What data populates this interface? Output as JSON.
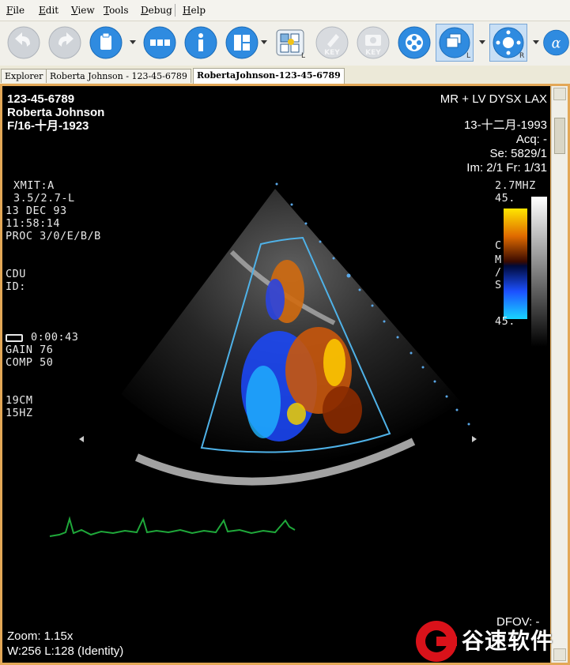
{
  "menu": {
    "items": [
      {
        "label": "File"
      },
      {
        "label": "Edit"
      },
      {
        "label": "View"
      },
      {
        "label": "Tools"
      },
      {
        "label": "Debug"
      },
      {
        "label": "Help"
      }
    ]
  },
  "toolbar": {
    "buttons": [
      {
        "name": "back-icon"
      },
      {
        "name": "forward-icon"
      },
      {
        "name": "clipboard-icon"
      },
      {
        "name": "layout-grid-icon"
      },
      {
        "name": "info-icon"
      },
      {
        "name": "tile-layout-icon"
      },
      {
        "name": "select-region-icon"
      },
      {
        "name": "key-pen-icon",
        "text": "KEY"
      },
      {
        "name": "key-camera-icon",
        "text": "KEY"
      },
      {
        "name": "cine-reel-icon"
      },
      {
        "name": "stack-icon",
        "sub": "L"
      },
      {
        "name": "pan-tool-icon",
        "sub": "R"
      },
      {
        "name": "alpha-icon",
        "text": "α"
      }
    ]
  },
  "tabs": [
    {
      "label": "Explorer"
    },
    {
      "label": "Roberta Johnson - 123-45-6789"
    },
    {
      "label": "RobertaJohnson-123-45-6789",
      "active": true
    }
  ],
  "overlay": {
    "patient_id": "123-45-6789",
    "patient_name": "Roberta Johnson",
    "patient_sex_dob": "F/16-十月-1923",
    "study_desc": "MR + LV DYSX LAX",
    "study_date": "13-十二月-1993",
    "acq": "Acq: -",
    "series": "Se: 5829/1",
    "image": "Im: 2/1 Fr: 1/31",
    "burned": {
      "xmit": "XMIT:A",
      "freq": "3.5/2.7-L",
      "date": "13 DEC 93",
      "time": "11:58:14",
      "proc": "PROC 3/0/E/B/B",
      "cdu": "CDU",
      "id": "ID:",
      "clock": "0:00:43",
      "gain": "GAIN 76",
      "comp": "COMP 50",
      "depth": "19CM",
      "rate": "15HZ",
      "mhz": "2.7MHZ",
      "scale_top": "45.",
      "scale_bottom": "45.",
      "cms": [
        "C",
        "M",
        "/",
        "S"
      ]
    },
    "zoom": "Zoom: 1.15x",
    "window_level": "W:256 L:128 (Identity)",
    "dfov": "DFOV: -"
  },
  "watermark": {
    "text": "谷速软件"
  },
  "colors": {
    "menubar": "#f4f3ee",
    "toolbar": "#f1f0ea",
    "viewer_bg": "#000000",
    "frame": "#e3a857",
    "sector_outline": "#4fb2e8",
    "ecg": "#1fa83a",
    "watermark_red": "#d9121a"
  }
}
